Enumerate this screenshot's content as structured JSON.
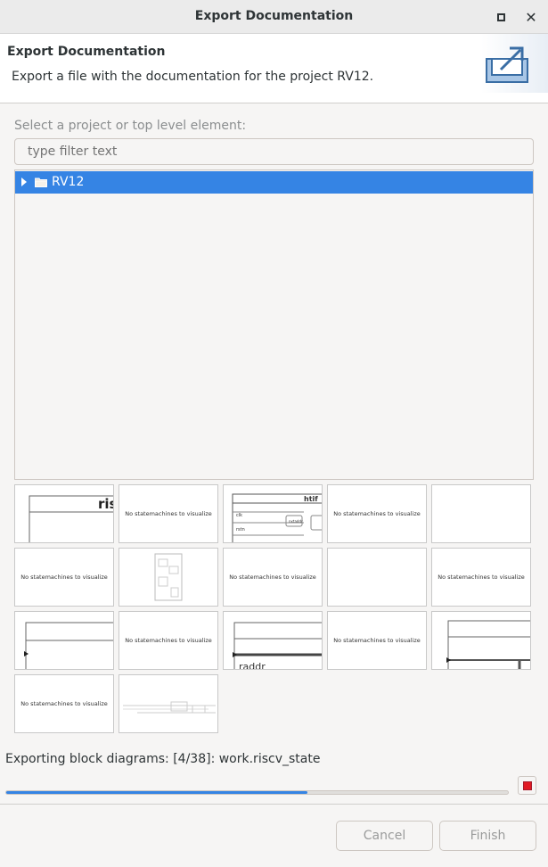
{
  "window": {
    "title": "Export Documentation"
  },
  "header": {
    "title": "Export Documentation",
    "description": "Export a file with the documentation for the project RV12."
  },
  "selector": {
    "label": "Select a project or top level element:",
    "filter_placeholder": "type filter text"
  },
  "tree": {
    "items": [
      {
        "label": "RV12",
        "selected": true,
        "expanded": false
      }
    ]
  },
  "thumbnails": {
    "empty_message": "No statemachines to visualize",
    "items": [
      {
        "kind": "diagram",
        "text": "ris"
      },
      {
        "kind": "message"
      },
      {
        "kind": "diagram",
        "text": "htif",
        "sub": [
          "clk",
          "rstn",
          "nxtaddr"
        ]
      },
      {
        "kind": "message"
      },
      {
        "kind": "blank"
      },
      {
        "kind": "message"
      },
      {
        "kind": "diagram-tiny"
      },
      {
        "kind": "message"
      },
      {
        "kind": "blank"
      },
      {
        "kind": "message"
      },
      {
        "kind": "diagram"
      },
      {
        "kind": "message"
      },
      {
        "kind": "diagram",
        "text": "raddr"
      },
      {
        "kind": "message"
      },
      {
        "kind": "diagram"
      },
      {
        "kind": "message"
      },
      {
        "kind": "diagram-tiny"
      }
    ]
  },
  "status": {
    "text": "Exporting block diagrams: [4/38]: work.riscv_state",
    "progress": 0.6
  },
  "buttons": {
    "cancel": "Cancel",
    "finish": "Finish"
  },
  "colors": {
    "accent": "#3584e4",
    "stop": "#e01b24"
  }
}
